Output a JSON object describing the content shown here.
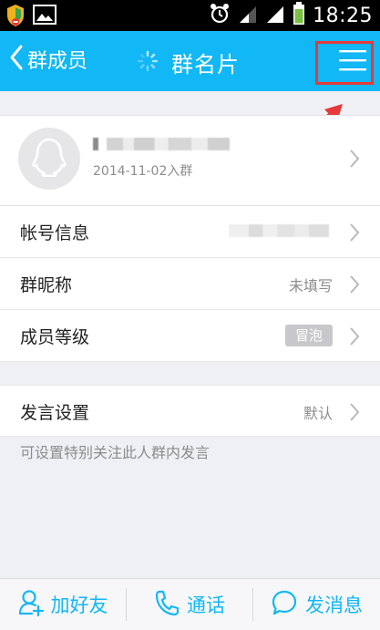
{
  "status_bar": {
    "time": "18:25"
  },
  "navbar": {
    "back_label": "群成员",
    "title": "群名片"
  },
  "profile": {
    "join_date": "2014-11-02入群"
  },
  "rows": {
    "account_info_label": "帐号信息",
    "nickname_label": "群昵称",
    "nickname_value": "未填写",
    "level_label": "成员等级",
    "level_badge": "冒泡",
    "speak_settings_label": "发言设置",
    "speak_settings_value": "默认"
  },
  "hint": "可设置特别关注此人群内发言",
  "bottom_bar": {
    "add_friend": "加好友",
    "call": "通话",
    "send_message": "发消息"
  },
  "colors": {
    "nav_bg": "#12b7f5",
    "accent": "#12b7f5",
    "annotation": "#e53a3a"
  }
}
